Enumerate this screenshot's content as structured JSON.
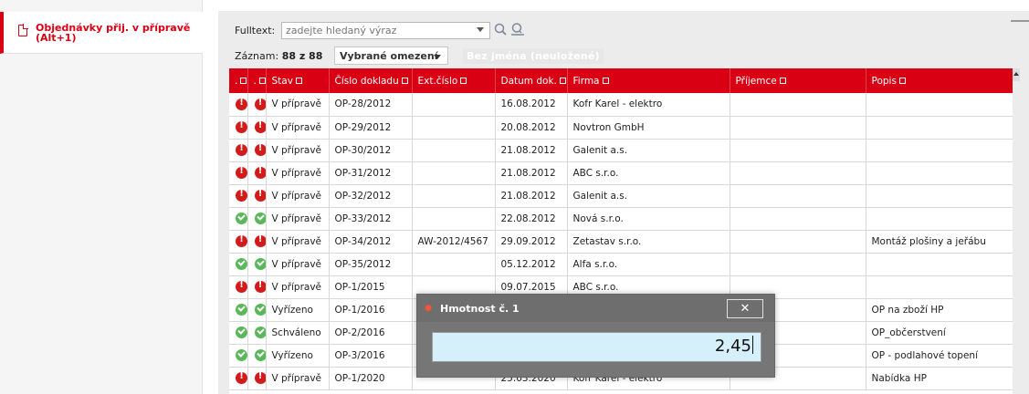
{
  "sidebar": {
    "active_item": "Objednávky přij. v přípravě\n(Alt+1)"
  },
  "toolbar": {
    "fulltext_label": "Fulltext:",
    "fulltext_placeholder": "zadejte hledaný výraz",
    "record_label": "Záznam:",
    "record_count": "88 z 88",
    "filter_selected": "Vybrané omezení",
    "no_name_label": "Bez jména (neuložené)"
  },
  "table": {
    "headers": [
      ".",
      ".",
      "Stav",
      "Číslo dokladu",
      "Ext.číslo",
      "Datum dok.",
      "Firma",
      "Příjemce",
      "Popis"
    ],
    "rows": [
      {
        "s1": "red",
        "s2": "red",
        "stav": "V přípravě",
        "cislo": "OP-28/2012",
        "ext": "",
        "datum": "16.08.2012",
        "firma": "Kofr Karel - elektro",
        "prijemce": "",
        "popis": ""
      },
      {
        "s1": "red",
        "s2": "red",
        "stav": "V přípravě",
        "cislo": "OP-29/2012",
        "ext": "",
        "datum": "20.08.2012",
        "firma": "Novtron GmbH",
        "prijemce": "",
        "popis": ""
      },
      {
        "s1": "red",
        "s2": "red",
        "stav": "V přípravě",
        "cislo": "OP-30/2012",
        "ext": "",
        "datum": "21.08.2012",
        "firma": "Galenit a.s.",
        "prijemce": "",
        "popis": ""
      },
      {
        "s1": "red",
        "s2": "red",
        "stav": "V přípravě",
        "cislo": "OP-31/2012",
        "ext": "",
        "datum": "21.08.2012",
        "firma": "ABC s.r.o.",
        "prijemce": "",
        "popis": ""
      },
      {
        "s1": "red",
        "s2": "red",
        "stav": "V přípravě",
        "cislo": "OP-32/2012",
        "ext": "",
        "datum": "21.08.2012",
        "firma": "Galenit a.s.",
        "prijemce": "",
        "popis": ""
      },
      {
        "s1": "green",
        "s2": "green",
        "stav": "V přípravě",
        "cislo": "OP-33/2012",
        "ext": "",
        "datum": "22.08.2012",
        "firma": "Nová s.r.o.",
        "prijemce": "",
        "popis": ""
      },
      {
        "s1": "red",
        "s2": "red",
        "stav": "V přípravě",
        "cislo": "OP-34/2012",
        "ext": "AW-2012/4567",
        "datum": "29.09.2012",
        "firma": "Zetastav s.r.o.",
        "prijemce": "",
        "popis": "Montáž plošiny a jeřábu"
      },
      {
        "s1": "green",
        "s2": "green",
        "stav": "V přípravě",
        "cislo": "OP-35/2012",
        "ext": "",
        "datum": "05.12.2012",
        "firma": "Alfa s.r.o.",
        "prijemce": "",
        "popis": ""
      },
      {
        "s1": "red",
        "s2": "red",
        "stav": "V přípravě",
        "cislo": "OP-1/2015",
        "ext": "",
        "datum": "09.07.2015",
        "firma": "ABC s.r.o.",
        "prijemce": "",
        "popis": ""
      },
      {
        "s1": "green",
        "s2": "green",
        "stav": "Vyřízeno",
        "cislo": "OP-1/2016",
        "ext": "",
        "datum": "",
        "firma": "",
        "prijemce": "",
        "popis": "OP na zboží HP"
      },
      {
        "s1": "green",
        "s2": "green",
        "stav": "Schváleno",
        "cislo": "OP-2/2016",
        "ext": "",
        "datum": "",
        "firma": "",
        "prijemce": "",
        "popis": "OP_občerstvení"
      },
      {
        "s1": "green",
        "s2": "green",
        "stav": "Vyřízeno",
        "cislo": "OP-3/2016",
        "ext": "",
        "datum": "",
        "firma": "",
        "prijemce": "",
        "popis": "OP - podlahové topení"
      },
      {
        "s1": "red",
        "s2": "red",
        "stav": "V přípravě",
        "cislo": "OP-1/2020",
        "ext": "",
        "datum": "25.03.2020",
        "firma": "Kofr Karel - elektro",
        "prijemce": "",
        "popis": "Nabídka HP"
      }
    ]
  },
  "dialog": {
    "title": "Hmotnost č. 1",
    "close_label": "✕",
    "value": "2,45"
  },
  "colors": {
    "accent": "#d90013",
    "status_red": "#d21b1b",
    "status_green": "#5ab75a",
    "input_bg": "#d6f0fb"
  }
}
